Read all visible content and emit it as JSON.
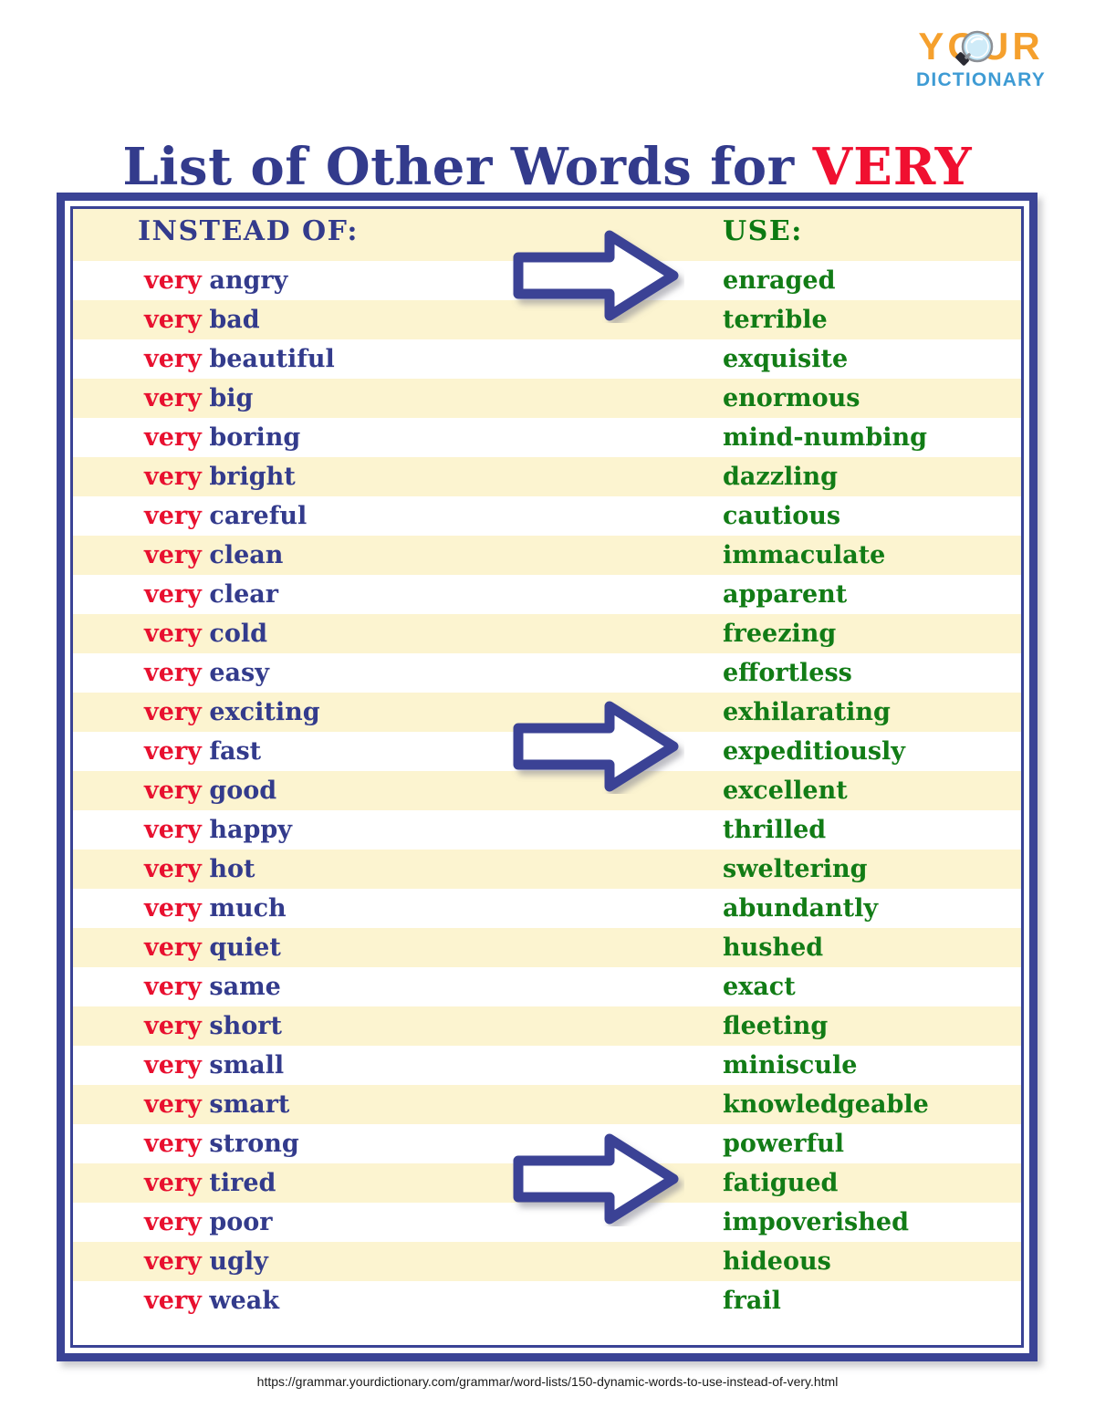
{
  "logo": {
    "word_top": "YOUR",
    "word_bottom": "DICTIONARY",
    "icon": "magnifying-glass-icon",
    "color_top": "#F5A02D",
    "color_bottom": "#3E9BD4"
  },
  "title": {
    "main": "List of Other Words for",
    "accent": "VERY",
    "color_main": "#333B8C",
    "color_accent": "#F01030"
  },
  "table": {
    "headers": {
      "left": "INSTEAD OF:",
      "right": "USE:",
      "left_color": "#333B8C",
      "right_color": "#0C7A12",
      "band_color": "#FCF4D0"
    },
    "prefix_word": "very",
    "prefix_color": "#E8102F",
    "adjective_color": "#333B8C",
    "replacement_color": "#127C16",
    "stripe_color": "#FCF4D0",
    "rows": [
      {
        "instead_of": "angry",
        "use": "enraged"
      },
      {
        "instead_of": "bad",
        "use": "terrible"
      },
      {
        "instead_of": "beautiful",
        "use": "exquisite"
      },
      {
        "instead_of": "big",
        "use": "enormous"
      },
      {
        "instead_of": "boring",
        "use": "mind-numbing"
      },
      {
        "instead_of": "bright",
        "use": "dazzling"
      },
      {
        "instead_of": "careful",
        "use": "cautious"
      },
      {
        "instead_of": "clean",
        "use": "immaculate"
      },
      {
        "instead_of": "clear",
        "use": "apparent"
      },
      {
        "instead_of": "cold",
        "use": "freezing"
      },
      {
        "instead_of": "easy",
        "use": "effortless"
      },
      {
        "instead_of": "exciting",
        "use": "exhilarating"
      },
      {
        "instead_of": "fast",
        "use": "expeditiously"
      },
      {
        "instead_of": "good",
        "use": "excellent"
      },
      {
        "instead_of": "happy",
        "use": "thrilled"
      },
      {
        "instead_of": "hot",
        "use": "sweltering"
      },
      {
        "instead_of": "much",
        "use": "abundantly"
      },
      {
        "instead_of": "quiet",
        "use": "hushed"
      },
      {
        "instead_of": "same",
        "use": "exact"
      },
      {
        "instead_of": "short",
        "use": "fleeting"
      },
      {
        "instead_of": "small",
        "use": "miniscule"
      },
      {
        "instead_of": "smart",
        "use": "knowledgeable"
      },
      {
        "instead_of": "strong",
        "use": "powerful"
      },
      {
        "instead_of": "tired",
        "use": "fatigued"
      },
      {
        "instead_of": "poor",
        "use": "impoverished"
      },
      {
        "instead_of": "ugly",
        "use": "hideous"
      },
      {
        "instead_of": "weak",
        "use": "frail"
      }
    ]
  },
  "arrows": {
    "count": 3,
    "icon": "right-arrow-icon",
    "fill": "#ffffff",
    "stroke": "#3A4395"
  },
  "frame": {
    "border_color": "#3A4395"
  },
  "footer": {
    "url": "https://grammar.yourdictionary.com/grammar/word-lists/150-dynamic-words-to-use-instead-of-very.html"
  }
}
